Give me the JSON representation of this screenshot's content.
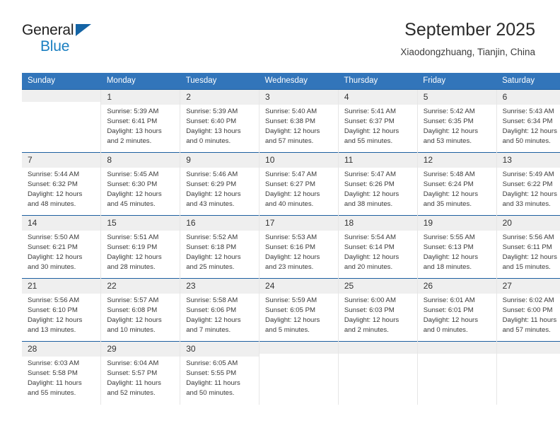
{
  "brand": {
    "name_part1": "General",
    "name_part2": "Blue"
  },
  "header": {
    "title": "September 2025",
    "location": "Xiaodongzhuang, Tianjin, China"
  },
  "weekday_headers": [
    "Sunday",
    "Monday",
    "Tuesday",
    "Wednesday",
    "Thursday",
    "Friday",
    "Saturday"
  ],
  "labels": {
    "sunrise_prefix": "Sunrise:",
    "sunset_prefix": "Sunset:",
    "daylight_prefix": "Daylight:"
  },
  "colors": {
    "header_blue": "#3275ba",
    "row_rule_blue": "#1d5fa0",
    "daynum_band": "#efefef",
    "logo_blue": "#1a7fc1",
    "logo_triangle": "#1464a5"
  },
  "weeks": [
    [
      {
        "day": "",
        "sunrise": "",
        "sunset": "",
        "daylight_l1": "",
        "daylight_l2": "",
        "empty": true
      },
      {
        "day": "1",
        "sunrise": "Sunrise: 5:39 AM",
        "sunset": "Sunset: 6:41 PM",
        "daylight_l1": "Daylight: 13 hours",
        "daylight_l2": "and 2 minutes."
      },
      {
        "day": "2",
        "sunrise": "Sunrise: 5:39 AM",
        "sunset": "Sunset: 6:40 PM",
        "daylight_l1": "Daylight: 13 hours",
        "daylight_l2": "and 0 minutes."
      },
      {
        "day": "3",
        "sunrise": "Sunrise: 5:40 AM",
        "sunset": "Sunset: 6:38 PM",
        "daylight_l1": "Daylight: 12 hours",
        "daylight_l2": "and 57 minutes."
      },
      {
        "day": "4",
        "sunrise": "Sunrise: 5:41 AM",
        "sunset": "Sunset: 6:37 PM",
        "daylight_l1": "Daylight: 12 hours",
        "daylight_l2": "and 55 minutes."
      },
      {
        "day": "5",
        "sunrise": "Sunrise: 5:42 AM",
        "sunset": "Sunset: 6:35 PM",
        "daylight_l1": "Daylight: 12 hours",
        "daylight_l2": "and 53 minutes."
      },
      {
        "day": "6",
        "sunrise": "Sunrise: 5:43 AM",
        "sunset": "Sunset: 6:34 PM",
        "daylight_l1": "Daylight: 12 hours",
        "daylight_l2": "and 50 minutes."
      }
    ],
    [
      {
        "day": "7",
        "sunrise": "Sunrise: 5:44 AM",
        "sunset": "Sunset: 6:32 PM",
        "daylight_l1": "Daylight: 12 hours",
        "daylight_l2": "and 48 minutes."
      },
      {
        "day": "8",
        "sunrise": "Sunrise: 5:45 AM",
        "sunset": "Sunset: 6:30 PM",
        "daylight_l1": "Daylight: 12 hours",
        "daylight_l2": "and 45 minutes."
      },
      {
        "day": "9",
        "sunrise": "Sunrise: 5:46 AM",
        "sunset": "Sunset: 6:29 PM",
        "daylight_l1": "Daylight: 12 hours",
        "daylight_l2": "and 43 minutes."
      },
      {
        "day": "10",
        "sunrise": "Sunrise: 5:47 AM",
        "sunset": "Sunset: 6:27 PM",
        "daylight_l1": "Daylight: 12 hours",
        "daylight_l2": "and 40 minutes."
      },
      {
        "day": "11",
        "sunrise": "Sunrise: 5:47 AM",
        "sunset": "Sunset: 6:26 PM",
        "daylight_l1": "Daylight: 12 hours",
        "daylight_l2": "and 38 minutes."
      },
      {
        "day": "12",
        "sunrise": "Sunrise: 5:48 AM",
        "sunset": "Sunset: 6:24 PM",
        "daylight_l1": "Daylight: 12 hours",
        "daylight_l2": "and 35 minutes."
      },
      {
        "day": "13",
        "sunrise": "Sunrise: 5:49 AM",
        "sunset": "Sunset: 6:22 PM",
        "daylight_l1": "Daylight: 12 hours",
        "daylight_l2": "and 33 minutes."
      }
    ],
    [
      {
        "day": "14",
        "sunrise": "Sunrise: 5:50 AM",
        "sunset": "Sunset: 6:21 PM",
        "daylight_l1": "Daylight: 12 hours",
        "daylight_l2": "and 30 minutes."
      },
      {
        "day": "15",
        "sunrise": "Sunrise: 5:51 AM",
        "sunset": "Sunset: 6:19 PM",
        "daylight_l1": "Daylight: 12 hours",
        "daylight_l2": "and 28 minutes."
      },
      {
        "day": "16",
        "sunrise": "Sunrise: 5:52 AM",
        "sunset": "Sunset: 6:18 PM",
        "daylight_l1": "Daylight: 12 hours",
        "daylight_l2": "and 25 minutes."
      },
      {
        "day": "17",
        "sunrise": "Sunrise: 5:53 AM",
        "sunset": "Sunset: 6:16 PM",
        "daylight_l1": "Daylight: 12 hours",
        "daylight_l2": "and 23 minutes."
      },
      {
        "day": "18",
        "sunrise": "Sunrise: 5:54 AM",
        "sunset": "Sunset: 6:14 PM",
        "daylight_l1": "Daylight: 12 hours",
        "daylight_l2": "and 20 minutes."
      },
      {
        "day": "19",
        "sunrise": "Sunrise: 5:55 AM",
        "sunset": "Sunset: 6:13 PM",
        "daylight_l1": "Daylight: 12 hours",
        "daylight_l2": "and 18 minutes."
      },
      {
        "day": "20",
        "sunrise": "Sunrise: 5:56 AM",
        "sunset": "Sunset: 6:11 PM",
        "daylight_l1": "Daylight: 12 hours",
        "daylight_l2": "and 15 minutes."
      }
    ],
    [
      {
        "day": "21",
        "sunrise": "Sunrise: 5:56 AM",
        "sunset": "Sunset: 6:10 PM",
        "daylight_l1": "Daylight: 12 hours",
        "daylight_l2": "and 13 minutes."
      },
      {
        "day": "22",
        "sunrise": "Sunrise: 5:57 AM",
        "sunset": "Sunset: 6:08 PM",
        "daylight_l1": "Daylight: 12 hours",
        "daylight_l2": "and 10 minutes."
      },
      {
        "day": "23",
        "sunrise": "Sunrise: 5:58 AM",
        "sunset": "Sunset: 6:06 PM",
        "daylight_l1": "Daylight: 12 hours",
        "daylight_l2": "and 7 minutes."
      },
      {
        "day": "24",
        "sunrise": "Sunrise: 5:59 AM",
        "sunset": "Sunset: 6:05 PM",
        "daylight_l1": "Daylight: 12 hours",
        "daylight_l2": "and 5 minutes."
      },
      {
        "day": "25",
        "sunrise": "Sunrise: 6:00 AM",
        "sunset": "Sunset: 6:03 PM",
        "daylight_l1": "Daylight: 12 hours",
        "daylight_l2": "and 2 minutes."
      },
      {
        "day": "26",
        "sunrise": "Sunrise: 6:01 AM",
        "sunset": "Sunset: 6:01 PM",
        "daylight_l1": "Daylight: 12 hours",
        "daylight_l2": "and 0 minutes."
      },
      {
        "day": "27",
        "sunrise": "Sunrise: 6:02 AM",
        "sunset": "Sunset: 6:00 PM",
        "daylight_l1": "Daylight: 11 hours",
        "daylight_l2": "and 57 minutes."
      }
    ],
    [
      {
        "day": "28",
        "sunrise": "Sunrise: 6:03 AM",
        "sunset": "Sunset: 5:58 PM",
        "daylight_l1": "Daylight: 11 hours",
        "daylight_l2": "and 55 minutes."
      },
      {
        "day": "29",
        "sunrise": "Sunrise: 6:04 AM",
        "sunset": "Sunset: 5:57 PM",
        "daylight_l1": "Daylight: 11 hours",
        "daylight_l2": "and 52 minutes."
      },
      {
        "day": "30",
        "sunrise": "Sunrise: 6:05 AM",
        "sunset": "Sunset: 5:55 PM",
        "daylight_l1": "Daylight: 11 hours",
        "daylight_l2": "and 50 minutes."
      },
      {
        "day": "",
        "sunrise": "",
        "sunset": "",
        "daylight_l1": "",
        "daylight_l2": "",
        "empty": true
      },
      {
        "day": "",
        "sunrise": "",
        "sunset": "",
        "daylight_l1": "",
        "daylight_l2": "",
        "empty": true
      },
      {
        "day": "",
        "sunrise": "",
        "sunset": "",
        "daylight_l1": "",
        "daylight_l2": "",
        "empty": true
      },
      {
        "day": "",
        "sunrise": "",
        "sunset": "",
        "daylight_l1": "",
        "daylight_l2": "",
        "empty": true
      }
    ]
  ]
}
